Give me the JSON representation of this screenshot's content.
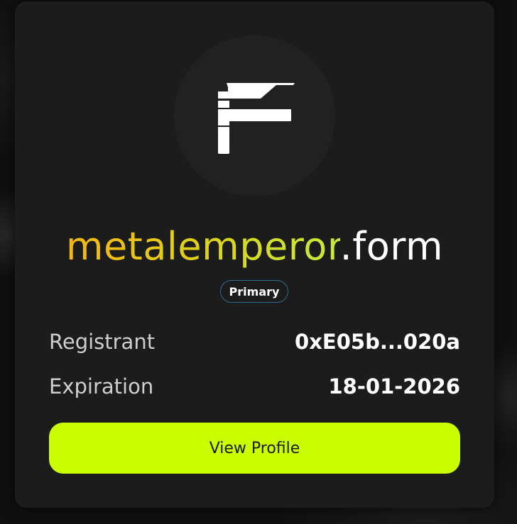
{
  "profile": {
    "logo_icon": "form-f-logo-icon",
    "domain_label": "metalemperor",
    "domain_tld": ".form",
    "badge": "Primary",
    "registrant": {
      "label": "Registrant",
      "value": "0xE05b...020a"
    },
    "expiration": {
      "label": "Expiration",
      "value": "18-01-2026"
    },
    "button_label": "View Profile"
  },
  "colors": {
    "accent": "#c9ff00",
    "card_background": "#1c1c1c",
    "gradient_start": "#f4b615",
    "gradient_end": "#c6ea3d",
    "badge_border": "#2d6e8c"
  }
}
